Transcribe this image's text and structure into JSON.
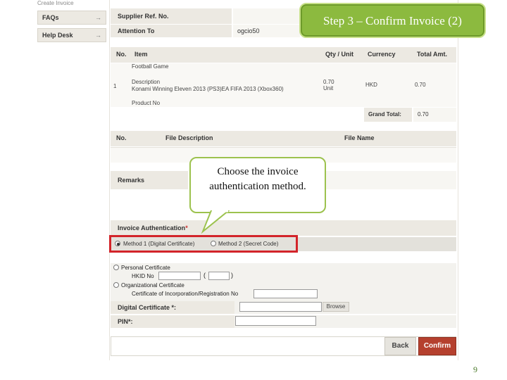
{
  "sidebar": {
    "top_label": "Create Invoice",
    "items": [
      {
        "label": "FAQs",
        "arrow": "→"
      },
      {
        "label": "Help Desk",
        "arrow": "→"
      }
    ]
  },
  "header_rows": [
    {
      "label": "Supplier Ref. No.",
      "value": ""
    },
    {
      "label": "Attention To",
      "value": "ogcio50"
    }
  ],
  "items_table": {
    "columns": [
      "No.",
      "Item",
      "Qty / Unit",
      "Currency",
      "Total Amt."
    ],
    "row": {
      "no": "1",
      "lines": [
        "Football Game",
        "Description",
        "Konami Winning Eleven 2013 (PS3)EA FIFA 2013 (Xbox360)",
        "Product No"
      ],
      "qty": "0.70",
      "unit": "Unit",
      "currency": "HKD",
      "total": "0.70"
    },
    "grand_total_label": "Grand Total:",
    "grand_total_value": "0.70"
  },
  "attachments_table": {
    "columns": [
      "No.",
      "File Description",
      "File Name"
    ]
  },
  "remarks_label": "Remarks",
  "auth": {
    "label": "Invoice Authentication",
    "required_mark": "*",
    "method1": "Method 1 (Digital Certificate)",
    "method2": "Method 2 (Secret Code)",
    "personal_cert": "Personal Certificate",
    "hkid_label": "HKID No",
    "paren_open": "(",
    "paren_close": ")",
    "org_cert": "Organizational Certificate",
    "cert_inc_label": "Certificate of Incorporation/Registration No",
    "digital_cert_label": "Digital Certificate *:",
    "browse_label": "Browse",
    "pin_label": "PIN*:"
  },
  "buttons": {
    "back": "Back",
    "confirm": "Confirm"
  },
  "callouts": {
    "step_title": "Step 3 – Confirm Invoice (2)",
    "bubble_text": "Choose the invoice authentication method."
  },
  "page_number": "9",
  "colors": {
    "accent_green": "#8cba3f",
    "highlight_red": "#d3242a",
    "confirm_red": "#b5402e"
  }
}
